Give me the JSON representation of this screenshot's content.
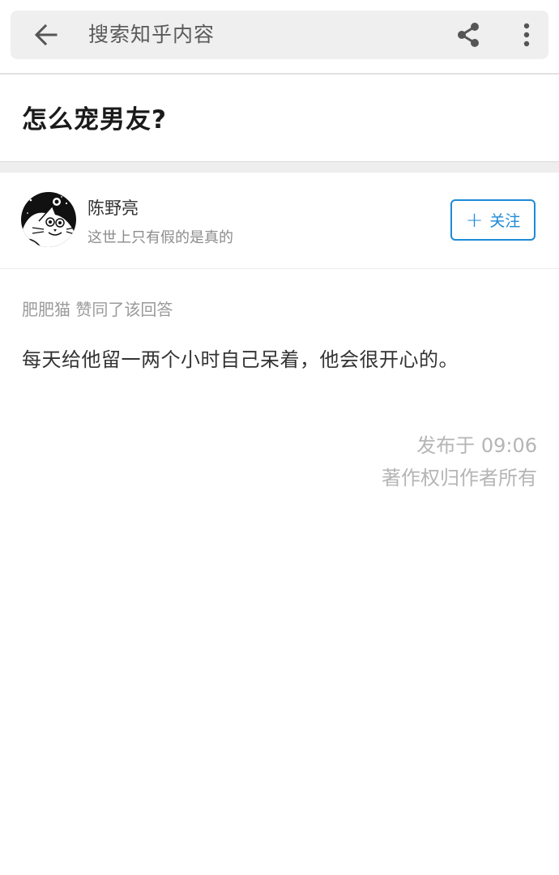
{
  "topbar": {
    "search_placeholder": "搜索知乎内容",
    "back_icon": "arrow-left-icon",
    "share_icon": "share-icon",
    "more_icon": "more-vertical-icon"
  },
  "question": {
    "title": "怎么宠男友?"
  },
  "author": {
    "name": "陈野亮",
    "bio": "这世上只有假的是真的",
    "avatar_icon": "cat-avatar",
    "follow_label": "关注",
    "follow_icon": "plus-icon"
  },
  "answer": {
    "voter_text": "肥肥猫 赞同了该回答",
    "content": "每天给他留一两个小时自己呆着，他会很开心的。",
    "published": "发布于 09:06",
    "copyright": "著作权归作者所有"
  },
  "colors": {
    "accent": "#1d8ad6",
    "search_bg": "#efefef",
    "muted_text": "#9a9a9a"
  }
}
